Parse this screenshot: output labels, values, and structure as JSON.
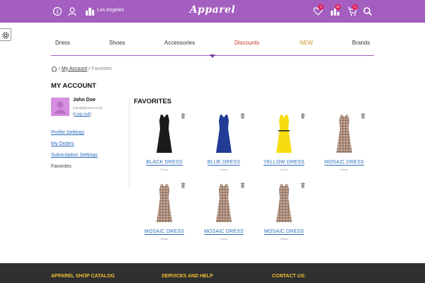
{
  "header": {
    "logo": "Apparel",
    "city": "Los Angeles",
    "icons": [
      "info-icon",
      "user-icon",
      "city-icon",
      "heart-icon",
      "stats-icon",
      "cart-icon",
      "search-icon"
    ],
    "wishlist_count": "0",
    "stats_count": "50",
    "cart_count": "0"
  },
  "settings_icon": "gear-icon",
  "nav": {
    "items": [
      {
        "label": "Dress",
        "color": "#333333"
      },
      {
        "label": "Shoes",
        "color": "#333333"
      },
      {
        "label": "Accessories",
        "color": "#333333"
      },
      {
        "label": "Discounts",
        "color": "#c0392b"
      },
      {
        "label": "NEW",
        "color": "#c7932c"
      },
      {
        "label": "Brands",
        "color": "#333333"
      }
    ]
  },
  "breadcrumb": {
    "home_icon": "home-icon",
    "items": [
      "My Account",
      "Favorites"
    ]
  },
  "account": {
    "title": "MY ACCOUNT",
    "user_name": "John Doe",
    "user_email": "[nimda@yahoo.com]",
    "logout_label": "Log out",
    "links": [
      "Profile Settings",
      "My Orders",
      "Subscription Settings",
      "Favorites"
    ]
  },
  "favorites": {
    "title": "FAVORITES",
    "items": [
      {
        "name": "BLACK DRESS",
        "category": "Dress",
        "color": "#1b1b1b"
      },
      {
        "name": "BLUE DRESS",
        "category": "Dress",
        "color": "#213b97"
      },
      {
        "name": "YELLOW DRESS",
        "category": "Dress",
        "color": "#f5dd12"
      },
      {
        "name": "MOSAIC DRESS",
        "category": "Dress",
        "color": "#b69a88"
      },
      {
        "name": "MOSAIC DRESS",
        "category": "Dress",
        "color": "#b69a88"
      },
      {
        "name": "MOSAIC DRESS",
        "category": "Dress",
        "color": "#b69a88"
      },
      {
        "name": "MOSAIC DRESS",
        "category": "Dress",
        "color": "#b69a88"
      }
    ]
  },
  "footer": {
    "headings": [
      "APPAREL SHOP CATALOG",
      "SERVICES AND HELP",
      "CONTACT US:"
    ]
  },
  "colors": {
    "brand": "#a35ebf",
    "link": "#2a6bbd",
    "footer_bg": "#2f2f2f",
    "footer_heading": "#f1c232"
  }
}
